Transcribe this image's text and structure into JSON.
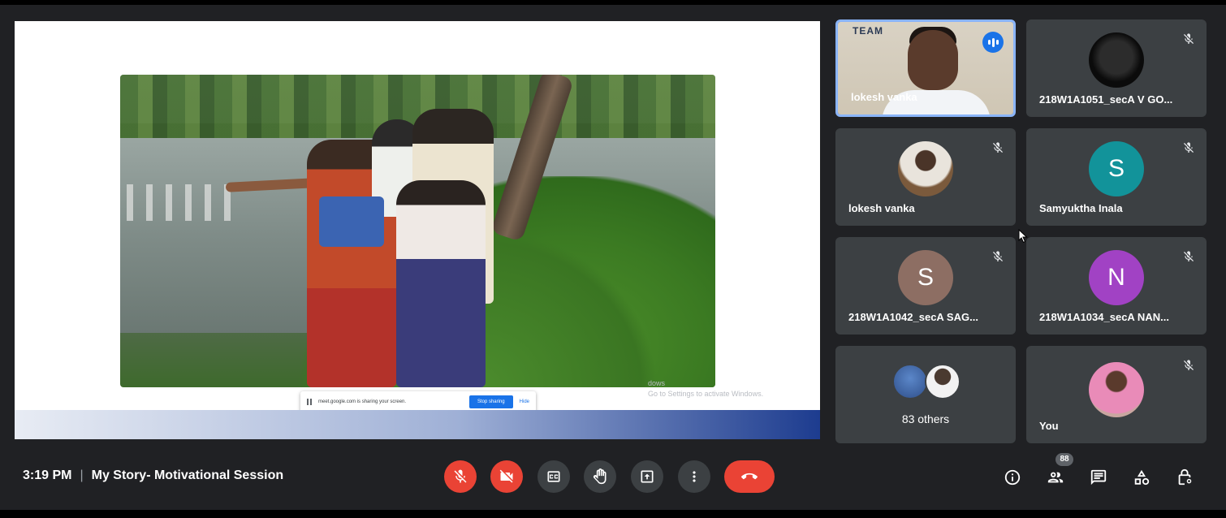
{
  "presentation": {
    "share_message": "meet.google.com is sharing your screen.",
    "stop_sharing_label": "Stop sharing",
    "hide_label": "Hide",
    "watermark_line1": "dows",
    "watermark_line2": "Go to Settings to activate Windows."
  },
  "tiles": [
    {
      "name": "lokesh vanka",
      "type": "video",
      "speaking": true,
      "video_logo": "TEAM"
    },
    {
      "name": "218W1A1051_secA V GO...",
      "type": "image-avatar",
      "muted": true
    },
    {
      "name": "lokesh vanka",
      "type": "photo-avatar",
      "muted": true
    },
    {
      "name": "Samyuktha Inala",
      "type": "letter",
      "letter": "S",
      "color": "#12939a",
      "muted": true
    },
    {
      "name": "218W1A1042_secA SAG...",
      "type": "letter",
      "letter": "S",
      "color": "#8d6e63",
      "muted": true
    },
    {
      "name": "218W1A1034_secA NAN...",
      "type": "letter",
      "letter": "N",
      "color": "#a142c4",
      "muted": true
    },
    {
      "name": "83 others",
      "type": "others"
    },
    {
      "name": "You",
      "type": "photo-avatar",
      "muted": true
    }
  ],
  "bottom_bar": {
    "time": "3:19 PM",
    "separator": "|",
    "meeting_title": "My Story- Motivational Session",
    "participants_count": "88",
    "controls": [
      "mic-off",
      "camera-off",
      "captions",
      "raise-hand",
      "present",
      "more-options",
      "end-call"
    ],
    "right_icons": [
      "info",
      "people",
      "chat",
      "activities",
      "host-controls"
    ]
  },
  "colors": {
    "background": "#202124",
    "tile": "#3c4043",
    "danger": "#ea4335",
    "accent": "#1a73e8"
  }
}
